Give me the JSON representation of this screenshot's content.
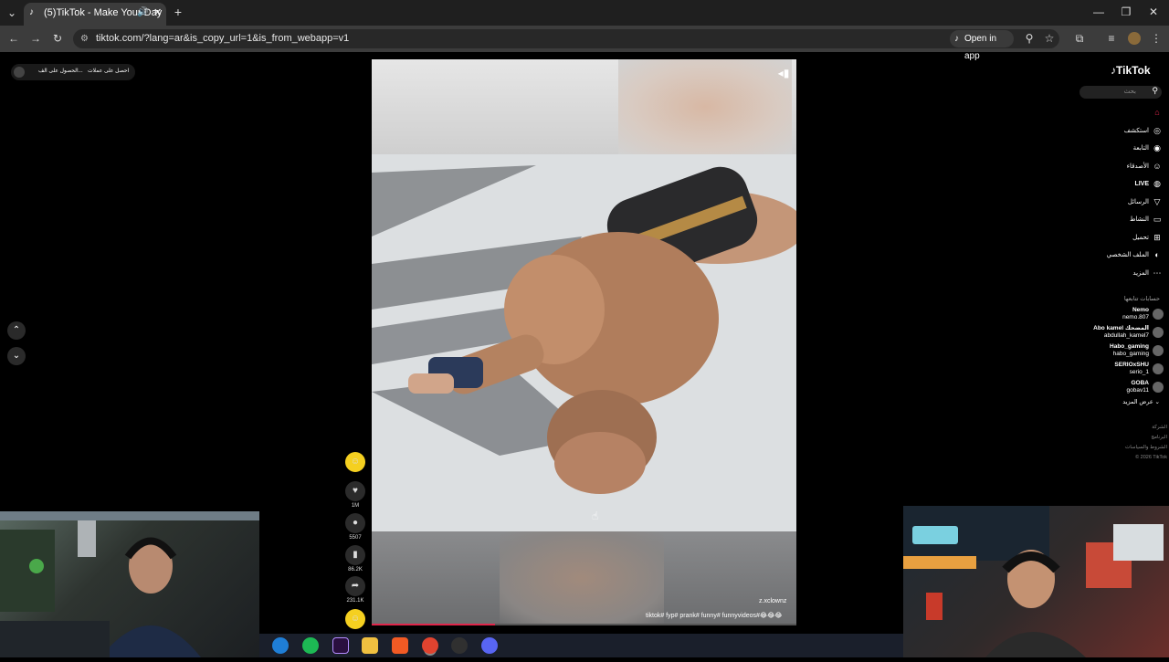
{
  "browser": {
    "tab_title": "(5)TikTok - Make Your Day",
    "url": "tiktok.com/?lang=ar&is_copy_url=1&is_from_webapp=v1",
    "open_in_app": "Open in app"
  },
  "top_left": {
    "get_app": "الحصول على الف...",
    "get_coins": "احصل على عملات"
  },
  "video": {
    "creator": "z.xclownz",
    "caption": "tiktok# fyp# prank# funny# funnyvideos#😂😂😂",
    "progress": 0.29
  },
  "actions": [
    {
      "icon": "like-icon",
      "count": "1M"
    },
    {
      "icon": "comment-icon",
      "count": "5507"
    },
    {
      "icon": "bookmark-icon",
      "count": "86.2K"
    },
    {
      "icon": "share-icon",
      "count": "231.1K"
    }
  ],
  "sidebar": {
    "logo": "TikTok",
    "search_placeholder": "بحث",
    "items": [
      {
        "label": "",
        "icon": "home-icon"
      },
      {
        "label": "استكشف",
        "icon": "compass-icon"
      },
      {
        "label": "التابعة",
        "icon": "following-icon"
      },
      {
        "label": "الأصدقاء",
        "icon": "friends-icon"
      },
      {
        "label": "LIVE",
        "icon": "live-icon"
      },
      {
        "label": "الرسائل",
        "icon": "messages-icon"
      },
      {
        "label": "النشاط",
        "icon": "activity-icon"
      },
      {
        "label": "تحميل",
        "icon": "upload-icon"
      },
      {
        "label": "الملف الشخصي",
        "icon": "profile-icon"
      },
      {
        "label": "المزيد",
        "icon": "more-icon"
      }
    ],
    "following_title": "حسابات تتابعها",
    "following": [
      {
        "name": "Nemo",
        "handle": "nemo.807"
      },
      {
        "name": "Abo kamel المضحك",
        "handle": "abdullah_kamel7"
      },
      {
        "name": "Habo_gaming",
        "handle": "habo_gaming"
      },
      {
        "name": "SERIOxSHU",
        "handle": "serio_1"
      },
      {
        "name": "GOBA",
        "handle": "gobav11"
      }
    ],
    "see_more": "عرض المزيد",
    "footer": [
      "الشركة",
      "البرنامج",
      "الشروط والسياسات",
      "© 2026 TikTok"
    ]
  },
  "colors": {
    "accent": "#e0254a",
    "bg": "#000000"
  }
}
